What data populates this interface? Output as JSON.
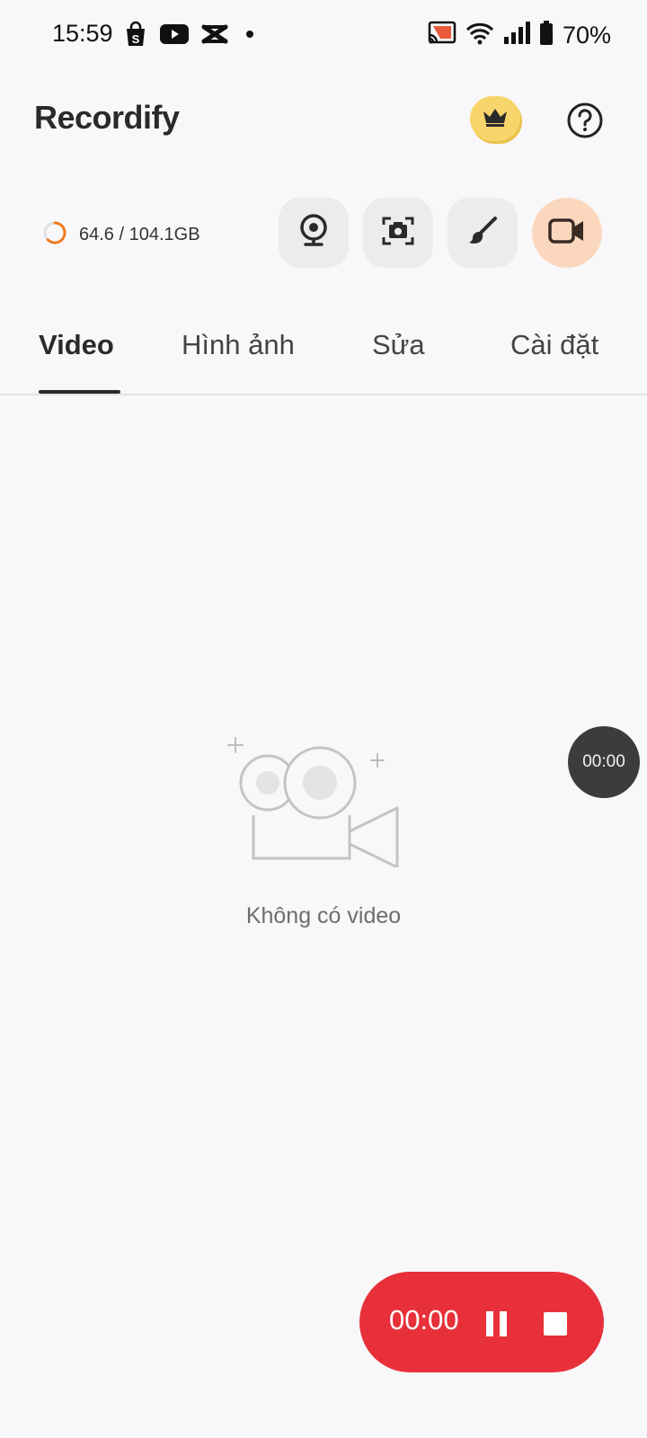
{
  "status_bar": {
    "time": "15:59",
    "battery": "70%",
    "icons_left": [
      "shopee-icon",
      "youtube-icon",
      "capcut-icon",
      "dot-icon"
    ],
    "icons_right": [
      "cast-icon",
      "wifi-icon",
      "signal-icon",
      "battery-icon"
    ]
  },
  "header": {
    "app_name": "Recordify",
    "premium_icon": "crown-icon",
    "help_icon": "help-icon"
  },
  "storage": {
    "text": "64.6 / 104.1GB",
    "used_fraction": 0.62,
    "ring_color": "#f07a1e"
  },
  "tools": [
    {
      "name": "webcam",
      "icon": "webcam-icon"
    },
    {
      "name": "screenshot",
      "icon": "screenshot-icon"
    },
    {
      "name": "brush",
      "icon": "brush-icon"
    },
    {
      "name": "record",
      "icon": "video-camera-icon"
    }
  ],
  "tabs": [
    {
      "label": "Video",
      "active": true
    },
    {
      "label": "Hình ảnh",
      "active": false
    },
    {
      "label": "Sửa",
      "active": false
    },
    {
      "label": "Cài đặt",
      "active": false
    }
  ],
  "empty_state": {
    "message": "Không có video",
    "icon": "empty-video-camera-icon"
  },
  "floating_timer": {
    "time": "00:00"
  },
  "recording_control": {
    "time": "00:00",
    "color": "#e8303a",
    "pause_icon": "pause-icon",
    "stop_icon": "stop-icon"
  }
}
